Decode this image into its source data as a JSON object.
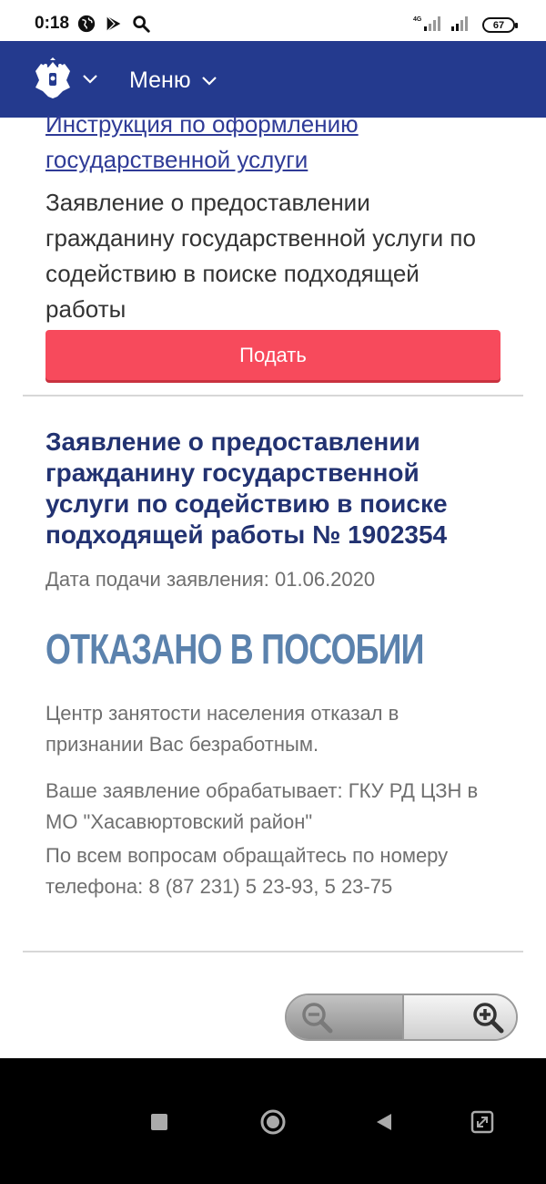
{
  "status_bar": {
    "time": "0:18",
    "battery": "67",
    "network": "4G"
  },
  "header": {
    "menu_label": "Меню"
  },
  "previous_item": {
    "instruction_link": "Инструкция по оформлению государственной услуги",
    "description": "Заявление о предоставлении гражданину государственной услуги по содействию в поиске подходящей работы",
    "submit_label": "Подать"
  },
  "application": {
    "title": "Заявление о предоставлении гражданину государственной услуги по содействию в поиске подходящей работы № 1902354",
    "date": "Дата подачи заявления: 01.06.2020",
    "status": "ОТКАЗАНО В ПОСОБИИ",
    "message": "Центр занятости населения отказал в признании Вас безработным.",
    "processor": "Ваше заявление обрабатывает: ГКУ РД ЦЗН в МО \"Хасавюртовский район\"",
    "contacts": "По всем вопросам обращайтесь по номеру телефона: 8 (87 231) 5 23-93, 5 23-75"
  },
  "icons": {
    "zoom_out": "zoom-out-icon",
    "zoom_in": "zoom-in-icon"
  },
  "colors": {
    "header": "#243a8e",
    "button": "#f74a5c",
    "status": "#5b82ad",
    "link": "#2f3b97"
  }
}
